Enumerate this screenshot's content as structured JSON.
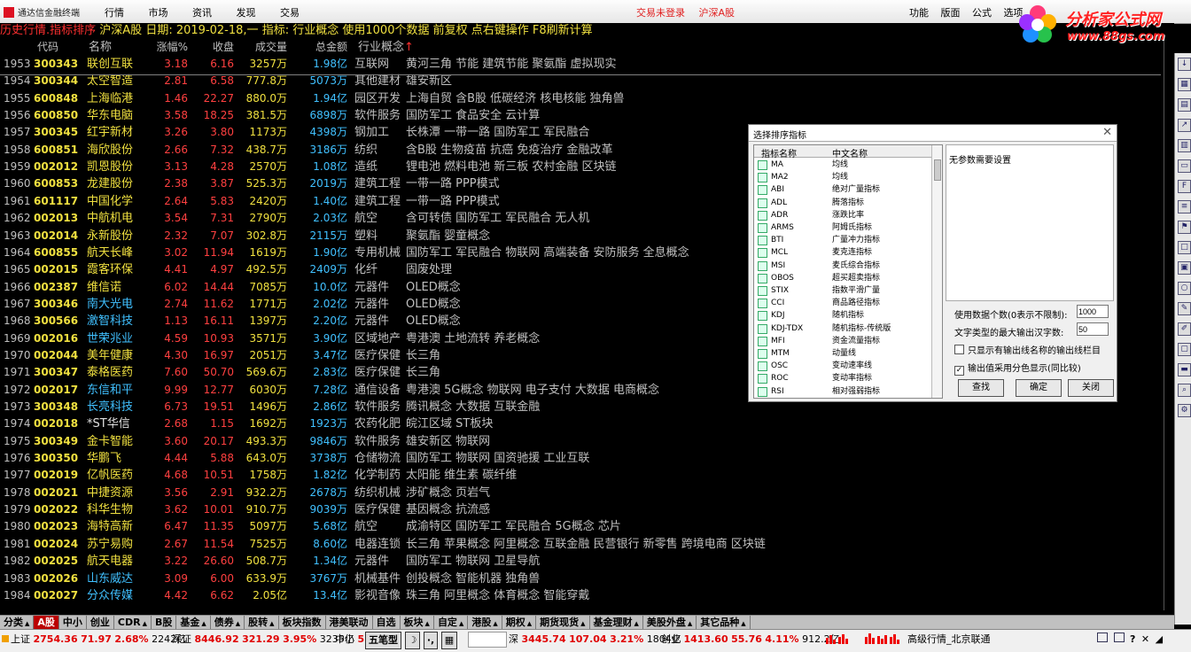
{
  "app": {
    "title": "通达信金融终端",
    "menu": [
      "行情",
      "市场",
      "资讯",
      "发现",
      "交易"
    ],
    "trade_status": "交易未登录",
    "market_mode": "沪深A股",
    "right_menu": [
      "功能",
      "版面",
      "公式",
      "选项"
    ],
    "brand_name": "分析家公式网",
    "brand_url": "www.88gs.com"
  },
  "info_strip": {
    "prefix": "历史行情.指标排序",
    "market": "沪深A股",
    "date_label": "日期:",
    "date": "2019-02-18,一",
    "indicator_label": "指标:",
    "indicator": "行业概念",
    "note": "使用1000个数据 前复权 点右键操作 F8刷新计算"
  },
  "table": {
    "headers": {
      "code": "代码",
      "name": "名称",
      "chg": "涨幅%",
      "close": "收盘",
      "vol": "成交量",
      "amt": "总金额",
      "ind": "行业概念",
      "sort_arrow": "↑"
    },
    "rows": [
      {
        "idx": "1953",
        "code": "300343",
        "name": "联创互联",
        "chg": "3.18",
        "close": "6.16",
        "vol": "3257万",
        "amt": "1.98亿",
        "ind": "互联网",
        "con": "黄河三角 节能 建筑节能 聚氨酯 虚拟现实",
        "nc": "y",
        "cc": "up"
      },
      {
        "idx": "1954",
        "code": "300344",
        "name": "太空智造",
        "chg": "2.81",
        "close": "6.58",
        "vol": "777.8万",
        "amt": "5073万",
        "ind": "其他建材",
        "con": "雄安新区",
        "nc": "y",
        "cc": "up"
      },
      {
        "idx": "1955",
        "code": "600848",
        "name": "上海临港",
        "chg": "1.46",
        "close": "22.27",
        "vol": "880.0万",
        "amt": "1.94亿",
        "ind": "园区开发",
        "con": "上海自贸 含B股 低碳经济 核电核能 独角兽",
        "nc": "y",
        "cc": "up"
      },
      {
        "idx": "1956",
        "code": "600850",
        "name": "华东电脑",
        "chg": "3.58",
        "close": "18.25",
        "vol": "381.5万",
        "amt": "6898万",
        "ind": "软件服务",
        "con": "国防军工 食品安全 云计算",
        "nc": "y",
        "cc": "up"
      },
      {
        "idx": "1957",
        "code": "300345",
        "name": "红宇新材",
        "chg": "3.26",
        "close": "3.80",
        "vol": "1173万",
        "amt": "4398万",
        "ind": "钢加工",
        "con": "长株潭 一带一路 国防军工 军民融合",
        "nc": "y",
        "cc": "up"
      },
      {
        "idx": "1958",
        "code": "600851",
        "name": "海欣股份",
        "chg": "2.66",
        "close": "7.32",
        "vol": "438.7万",
        "amt": "3186万",
        "ind": "纺织",
        "con": "含B股 生物疫苗 抗癌 免疫治疗 金融改革",
        "nc": "y",
        "cc": "up"
      },
      {
        "idx": "1959",
        "code": "002012",
        "name": "凯恩股份",
        "chg": "3.13",
        "close": "4.28",
        "vol": "2570万",
        "amt": "1.08亿",
        "ind": "造纸",
        "con": "锂电池 燃料电池 新三板 农村金融 区块链",
        "nc": "y",
        "cc": "up"
      },
      {
        "idx": "1960",
        "code": "600853",
        "name": "龙建股份",
        "chg": "2.38",
        "close": "3.87",
        "vol": "525.3万",
        "amt": "2019万",
        "ind": "建筑工程",
        "con": "一带一路 PPP模式",
        "nc": "y",
        "cc": "up"
      },
      {
        "idx": "1961",
        "code": "601117",
        "name": "中国化学",
        "chg": "2.64",
        "close": "5.83",
        "vol": "2420万",
        "amt": "1.40亿",
        "ind": "建筑工程",
        "con": "一带一路 PPP模式",
        "nc": "y",
        "cc": "up"
      },
      {
        "idx": "1962",
        "code": "002013",
        "name": "中航机电",
        "chg": "3.54",
        "close": "7.31",
        "vol": "2790万",
        "amt": "2.03亿",
        "ind": "航空",
        "con": "含可转债 国防军工 军民融合 无人机",
        "nc": "y",
        "cc": "up"
      },
      {
        "idx": "1963",
        "code": "002014",
        "name": "永新股份",
        "chg": "2.32",
        "close": "7.07",
        "vol": "302.8万",
        "amt": "2115万",
        "ind": "塑料",
        "con": "聚氨酯 婴童概念",
        "nc": "y",
        "cc": "up"
      },
      {
        "idx": "1964",
        "code": "600855",
        "name": "航天长峰",
        "chg": "3.02",
        "close": "11.94",
        "vol": "1619万",
        "amt": "1.90亿",
        "ind": "专用机械",
        "con": "国防军工 军民融合 物联网 高端装备 安防服务 全息概念",
        "nc": "y",
        "cc": "up"
      },
      {
        "idx": "1965",
        "code": "002015",
        "name": "霞客环保",
        "chg": "4.41",
        "close": "4.97",
        "vol": "492.5万",
        "amt": "2409万",
        "ind": "化纤",
        "con": "固废处理",
        "nc": "y",
        "cc": "up"
      },
      {
        "idx": "1966",
        "code": "002387",
        "name": "维信诺",
        "chg": "6.02",
        "close": "14.44",
        "vol": "7085万",
        "amt": "10.0亿",
        "ind": "元器件",
        "con": "OLED概念",
        "nc": "y",
        "cc": "up"
      },
      {
        "idx": "1967",
        "code": "300346",
        "name": "南大光电",
        "chg": "2.74",
        "close": "11.62",
        "vol": "1771万",
        "amt": "2.02亿",
        "ind": "元器件",
        "con": "OLED概念",
        "nc": "c",
        "cc": "up"
      },
      {
        "idx": "1968",
        "code": "300566",
        "name": "激智科技",
        "chg": "1.13",
        "close": "16.11",
        "vol": "1397万",
        "amt": "2.20亿",
        "ind": "元器件",
        "con": "OLED概念",
        "nc": "c",
        "cc": "up"
      },
      {
        "idx": "1969",
        "code": "002016",
        "name": "世荣兆业",
        "chg": "4.59",
        "close": "10.93",
        "vol": "3571万",
        "amt": "3.90亿",
        "ind": "区域地产",
        "con": "粤港澳 土地流转 养老概念",
        "nc": "c",
        "cc": "up"
      },
      {
        "idx": "1970",
        "code": "002044",
        "name": "美年健康",
        "chg": "4.30",
        "close": "16.97",
        "vol": "2051万",
        "amt": "3.47亿",
        "ind": "医疗保健",
        "con": "长三角",
        "nc": "y",
        "cc": "up"
      },
      {
        "idx": "1971",
        "code": "300347",
        "name": "泰格医药",
        "chg": "7.60",
        "close": "50.70",
        "vol": "569.6万",
        "amt": "2.83亿",
        "ind": "医疗保健",
        "con": "长三角",
        "nc": "y",
        "cc": "up"
      },
      {
        "idx": "1972",
        "code": "002017",
        "name": "东信和平",
        "chg": "9.99",
        "close": "12.77",
        "vol": "6030万",
        "amt": "7.28亿",
        "ind": "通信设备",
        "con": "粤港澳 5G概念 物联网 电子支付 大数据 电商概念",
        "nc": "c",
        "cc": "up"
      },
      {
        "idx": "1973",
        "code": "300348",
        "name": "长亮科技",
        "chg": "6.73",
        "close": "19.51",
        "vol": "1496万",
        "amt": "2.86亿",
        "ind": "软件服务",
        "con": "腾讯概念 大数据 互联金融",
        "nc": "c",
        "cc": "up"
      },
      {
        "idx": "1974",
        "code": "002018",
        "name": "*ST华信",
        "chg": "2.68",
        "close": "1.15",
        "vol": "1692万",
        "amt": "1923万",
        "ind": "农药化肥",
        "con": "皖江区域 ST板块",
        "nc": "w",
        "cc": "up"
      },
      {
        "idx": "1975",
        "code": "300349",
        "name": "金卡智能",
        "chg": "3.60",
        "close": "20.17",
        "vol": "493.3万",
        "amt": "9846万",
        "ind": "软件服务",
        "con": "雄安新区 物联网",
        "nc": "y",
        "cc": "up"
      },
      {
        "idx": "1976",
        "code": "300350",
        "name": "华鹏飞",
        "chg": "4.44",
        "close": "5.88",
        "vol": "643.0万",
        "amt": "3738万",
        "ind": "仓储物流",
        "con": "国防军工 物联网 国资驰援 工业互联",
        "nc": "y",
        "cc": "up"
      },
      {
        "idx": "1977",
        "code": "002019",
        "name": "亿帆医药",
        "chg": "4.68",
        "close": "10.51",
        "vol": "1758万",
        "amt": "1.82亿",
        "ind": "化学制药",
        "con": "太阳能 维生素 碳纤维",
        "nc": "y",
        "cc": "up"
      },
      {
        "idx": "1978",
        "code": "002021",
        "name": "中捷资源",
        "chg": "3.56",
        "close": "2.91",
        "vol": "932.2万",
        "amt": "2678万",
        "ind": "纺织机械",
        "con": "涉矿概念 页岩气",
        "nc": "y",
        "cc": "up"
      },
      {
        "idx": "1979",
        "code": "002022",
        "name": "科华生物",
        "chg": "3.62",
        "close": "10.01",
        "vol": "910.7万",
        "amt": "9039万",
        "ind": "医疗保健",
        "con": "基因概念 抗流感",
        "nc": "y",
        "cc": "up"
      },
      {
        "idx": "1980",
        "code": "002023",
        "name": "海特高新",
        "chg": "6.47",
        "close": "11.35",
        "vol": "5097万",
        "amt": "5.68亿",
        "ind": "航空",
        "con": "成渝特区 国防军工 军民融合 5G概念 芯片",
        "nc": "y",
        "cc": "up"
      },
      {
        "idx": "1981",
        "code": "002024",
        "name": "苏宁易购",
        "chg": "2.67",
        "close": "11.54",
        "vol": "7525万",
        "amt": "8.60亿",
        "ind": "电器连锁",
        "con": "长三角 苹果概念 阿里概念 互联金融 民营银行 新零售 跨境电商 区块链",
        "nc": "y",
        "cc": "up"
      },
      {
        "idx": "1982",
        "code": "002025",
        "name": "航天电器",
        "chg": "3.22",
        "close": "26.60",
        "vol": "508.7万",
        "amt": "1.34亿",
        "ind": "元器件",
        "con": "国防军工 物联网 卫星导航",
        "nc": "y",
        "cc": "up"
      },
      {
        "idx": "1983",
        "code": "002026",
        "name": "山东威达",
        "chg": "3.09",
        "close": "6.00",
        "vol": "633.9万",
        "amt": "3767万",
        "ind": "机械基件",
        "con": "创投概念 智能机器 独角兽",
        "nc": "c",
        "cc": "up"
      },
      {
        "idx": "1984",
        "code": "002027",
        "name": "分众传媒",
        "chg": "4.42",
        "close": "6.62",
        "vol": "2.05亿",
        "amt": "13.4亿",
        "ind": "影视音像",
        "con": "珠三角 阿里概念 体育概念 智能穿戴",
        "nc": "c",
        "cc": "up"
      }
    ]
  },
  "tabs": [
    {
      "label": "分类",
      "arrow": "▲"
    },
    {
      "label": "A股",
      "arrow": "",
      "active": true
    },
    {
      "label": "中小",
      "arrow": ""
    },
    {
      "label": "创业",
      "arrow": ""
    },
    {
      "label": "CDR",
      "arrow": "▲"
    },
    {
      "label": "B股",
      "arrow": ""
    },
    {
      "label": "基金",
      "arrow": "▲"
    },
    {
      "label": "债券",
      "arrow": "▲"
    },
    {
      "label": "股转",
      "arrow": "▲"
    },
    {
      "label": "板块指数",
      "arrow": ""
    },
    {
      "label": "港美联动",
      "arrow": ""
    },
    {
      "label": "自选",
      "arrow": ""
    },
    {
      "label": "板块",
      "arrow": "▲"
    },
    {
      "label": "自定",
      "arrow": "▲"
    },
    {
      "label": "港股",
      "arrow": "▲"
    },
    {
      "label": "期权",
      "arrow": "▲"
    },
    {
      "label": "期货现货",
      "arrow": "▲"
    },
    {
      "label": "基金理财",
      "arrow": "▲"
    },
    {
      "label": "美股外盘",
      "arrow": "▲"
    },
    {
      "label": "其它品种",
      "arrow": "▲"
    }
  ],
  "status": {
    "sh_label": "上证",
    "sh_index": "2754.36",
    "sh_chg": "71.97",
    "sh_pct": "2.68%",
    "sh_amt": "2242亿",
    "sz_label": "深证",
    "sz_index": "8446.92",
    "sz_chg": "321.29",
    "sz_pct": "3.95%",
    "sz_amt": "3235亿",
    "zx_label": "中小",
    "zx_value": "5",
    "tool_label": "五笔型",
    "cy_label_prefix": "深",
    "cy_index": "3445.74",
    "cy_chg": "107.04",
    "cy_pct": "3.21%",
    "cy_amt": "1804亿",
    "gem_label": "创业",
    "gem_index": "1413.60",
    "gem_chg": "55.76",
    "gem_pct": "4.11%",
    "gem_amt": "912.2亿",
    "server": "高级行情_北京联通"
  },
  "dialog": {
    "title": "选择排序指标",
    "col_name": "指标名称",
    "col_desc": "中文名称",
    "items": [
      {
        "n": "MA",
        "d": "均线"
      },
      {
        "n": "MA2",
        "d": "均线"
      },
      {
        "n": "ABI",
        "d": "绝对广量指标"
      },
      {
        "n": "ADL",
        "d": "腾落指标"
      },
      {
        "n": "ADR",
        "d": "涨跌比率"
      },
      {
        "n": "ARMS",
        "d": "阿姆氏指标"
      },
      {
        "n": "BTI",
        "d": "广量冲力指标"
      },
      {
        "n": "MCL",
        "d": "麦克连指标"
      },
      {
        "n": "MSI",
        "d": "麦氏综合指标"
      },
      {
        "n": "OBOS",
        "d": "超买超卖指标"
      },
      {
        "n": "STIX",
        "d": "指数平滑广量"
      },
      {
        "n": "CCI",
        "d": "商品路径指标"
      },
      {
        "n": "KDJ",
        "d": "随机指标"
      },
      {
        "n": "KDJ-TDX",
        "d": "随机指标-传统版"
      },
      {
        "n": "MFI",
        "d": "资金流量指标"
      },
      {
        "n": "MTM",
        "d": "动量线"
      },
      {
        "n": "OSC",
        "d": "变动速率线"
      },
      {
        "n": "ROC",
        "d": "变动率指标"
      },
      {
        "n": "RSI",
        "d": "相对强弱指标"
      }
    ],
    "no_params": "无参数需要设置",
    "count_label": "使用数据个数(0表示不限制):",
    "count_value": "1000",
    "maxlen_label": "文字类型的最大输出汉字数:",
    "maxlen_value": "50",
    "chk1_label": "只显示有输出线名称的输出线栏目",
    "chk2_label": "输出值采用分色显示(同比较)",
    "chk2_mark": "✓",
    "btn_find": "查找",
    "btn_ok": "确定",
    "btn_close": "关闭",
    "close_x": "✕"
  }
}
